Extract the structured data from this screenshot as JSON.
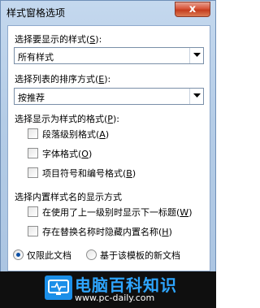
{
  "window": {
    "title": "样式窗格选项",
    "close_glyph": "x"
  },
  "style_to_show": {
    "label_prefix": "选择要显示的样式(",
    "label_key": "S",
    "label_suffix": "):",
    "value": "所有样式"
  },
  "sort_order": {
    "label_prefix": "选择列表的排序方式(",
    "label_key": "E",
    "label_suffix": "):",
    "value": "按推荐"
  },
  "formats": {
    "heading_prefix": "选择显示为样式的格式(",
    "heading_key": "P",
    "heading_suffix": "):",
    "items": [
      {
        "prefix": "段落级别格式(",
        "key": "A",
        "suffix": ")",
        "checked": false
      },
      {
        "prefix": "字体格式(",
        "key": "O",
        "suffix": ")",
        "checked": false
      },
      {
        "prefix": "项目符号和编号格式(",
        "key": "B",
        "suffix": ")",
        "checked": false
      }
    ]
  },
  "builtin_names": {
    "heading": "选择内置样式名的显示方式",
    "items": [
      {
        "prefix": "在使用了上一级别时显示下一标题(",
        "key": "W",
        "suffix": ")",
        "checked": false
      },
      {
        "prefix": "存在替换名称时隐藏内置名称(",
        "key": "H",
        "suffix": ")",
        "checked": false
      }
    ]
  },
  "scope": {
    "options": [
      {
        "prefix": "仅限此文档",
        "key": "",
        "suffix": "",
        "selected": true
      },
      {
        "prefix": "基于该模板的新文档",
        "key": "",
        "suffix": "",
        "selected": false
      }
    ]
  },
  "watermark": {
    "title": "电脑百科知识",
    "url": "www.pc-daily.com"
  },
  "colors": {
    "accent": "#2ea6ff",
    "title_bar": "#b4cce6",
    "close": "#d7553a"
  }
}
